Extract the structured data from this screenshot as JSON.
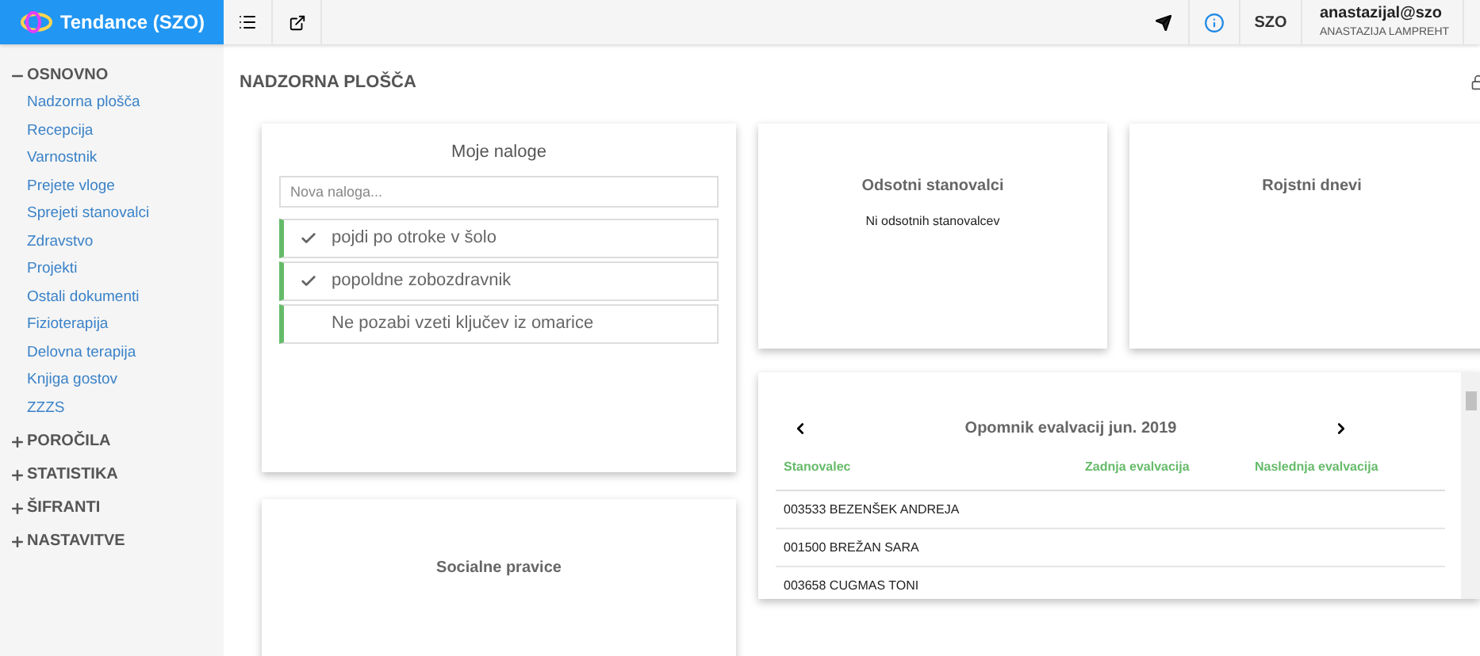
{
  "app": {
    "title": "Tendance (SZO)"
  },
  "header": {
    "org": "SZO",
    "user_email": "anastazijal@szo",
    "user_name": "ANASTAZIJA LAMPREHT"
  },
  "sidebar": {
    "sections": [
      {
        "label": "OSNOVNO",
        "expanded": true,
        "items": [
          "Nadzorna plošča",
          "Recepcija",
          "Varnostnik",
          "Prejete vloge",
          "Sprejeti stanovalci",
          "Zdravstvo",
          "Projekti",
          "Ostali dokumenti",
          "Fizioterapija",
          "Delovna terapija",
          "Knjiga gostov",
          "ZZZS"
        ]
      },
      {
        "label": "POROČILA",
        "expanded": false
      },
      {
        "label": "STATISTIKA",
        "expanded": false
      },
      {
        "label": "ŠIFRANTI",
        "expanded": false
      },
      {
        "label": "NASTAVITVE",
        "expanded": false
      }
    ]
  },
  "page": {
    "title": "NADZORNA PLOŠČA"
  },
  "tasks": {
    "title": "Moje naloge",
    "placeholder": "Nova naloga...",
    "items": [
      {
        "text": "pojdi po otroke v šolo",
        "checked": true
      },
      {
        "text": "popoldne zobozdravnik",
        "checked": true
      },
      {
        "text": "Ne pozabi vzeti ključev iz omarice",
        "checked": false
      }
    ]
  },
  "absent": {
    "title": "Odsotni stanovalci",
    "message": "Ni odsotnih stanovalcev"
  },
  "birthdays": {
    "title": "Rojstni dnevi"
  },
  "social": {
    "title": "Socialne pravice"
  },
  "evaluations": {
    "title": "Opomnik evalvacij jun. 2019",
    "columns": [
      "Stanovalec",
      "Zadnja evalvacija",
      "Naslednja evalvacija"
    ],
    "rows": [
      {
        "resident": "003533 BEZENŠEK ANDREJA"
      },
      {
        "resident": "001500 BREŽAN SARA"
      },
      {
        "resident": "003658 CUGMAS TONI"
      }
    ]
  }
}
